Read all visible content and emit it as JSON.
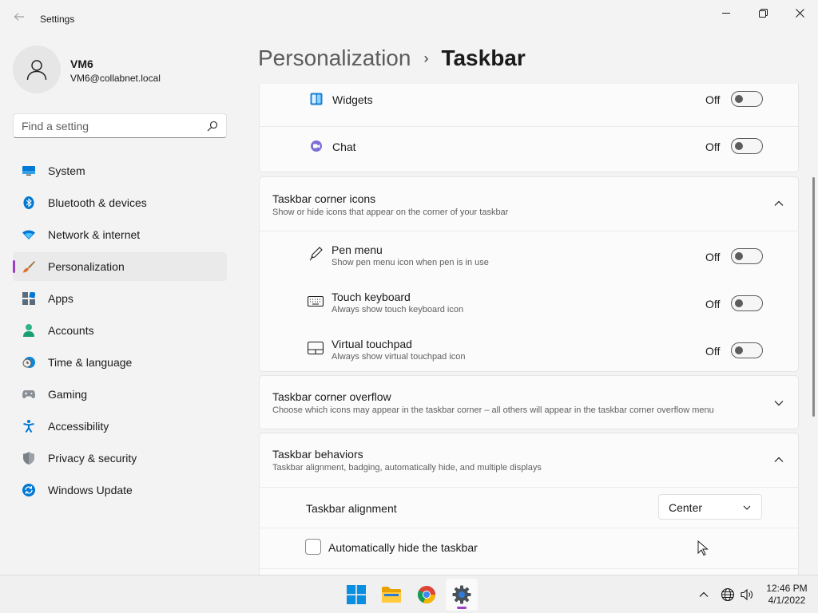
{
  "window": {
    "app_title": "Settings"
  },
  "account": {
    "name": "VM6",
    "email": "VM6@collabnet.local"
  },
  "search": {
    "placeholder": "Find a setting"
  },
  "nav": {
    "items": [
      {
        "label": "System",
        "icon": "monitor-icon"
      },
      {
        "label": "Bluetooth & devices",
        "icon": "bluetooth-icon"
      },
      {
        "label": "Network & internet",
        "icon": "wifi-icon"
      },
      {
        "label": "Personalization",
        "icon": "paintbrush-icon",
        "active": true
      },
      {
        "label": "Apps",
        "icon": "apps-icon"
      },
      {
        "label": "Accounts",
        "icon": "person-icon"
      },
      {
        "label": "Time & language",
        "icon": "clock-globe-icon"
      },
      {
        "label": "Gaming",
        "icon": "gamepad-icon"
      },
      {
        "label": "Accessibility",
        "icon": "accessibility-icon"
      },
      {
        "label": "Privacy & security",
        "icon": "shield-icon"
      },
      {
        "label": "Windows Update",
        "icon": "update-icon"
      }
    ]
  },
  "header": {
    "parent": "Personalization",
    "separator": "›",
    "current": "Taskbar"
  },
  "taskbar_items": {
    "widgets": {
      "label": "Widgets",
      "state": "Off"
    },
    "chat": {
      "label": "Chat",
      "state": "Off"
    }
  },
  "corner_icons": {
    "title": "Taskbar corner icons",
    "subtitle": "Show or hide icons that appear on the corner of your taskbar",
    "items": [
      {
        "label": "Pen menu",
        "sub": "Show pen menu icon when pen is in use",
        "state": "Off"
      },
      {
        "label": "Touch keyboard",
        "sub": "Always show touch keyboard icon",
        "state": "Off"
      },
      {
        "label": "Virtual touchpad",
        "sub": "Always show virtual touchpad icon",
        "state": "Off"
      }
    ]
  },
  "corner_overflow": {
    "title": "Taskbar corner overflow",
    "subtitle": "Choose which icons may appear in the taskbar corner – all others will appear in the taskbar corner overflow menu"
  },
  "behaviors": {
    "title": "Taskbar behaviors",
    "subtitle": "Taskbar alignment, badging, automatically hide, and multiple displays",
    "alignment_label": "Taskbar alignment",
    "alignment_value": "Center",
    "autohide_label": "Automatically hide the taskbar"
  },
  "system_tray": {
    "time": "12:46 PM",
    "date": "4/1/2022"
  },
  "colors": {
    "accent": "#9a3fc7",
    "windows_blue": "#0078d4"
  }
}
